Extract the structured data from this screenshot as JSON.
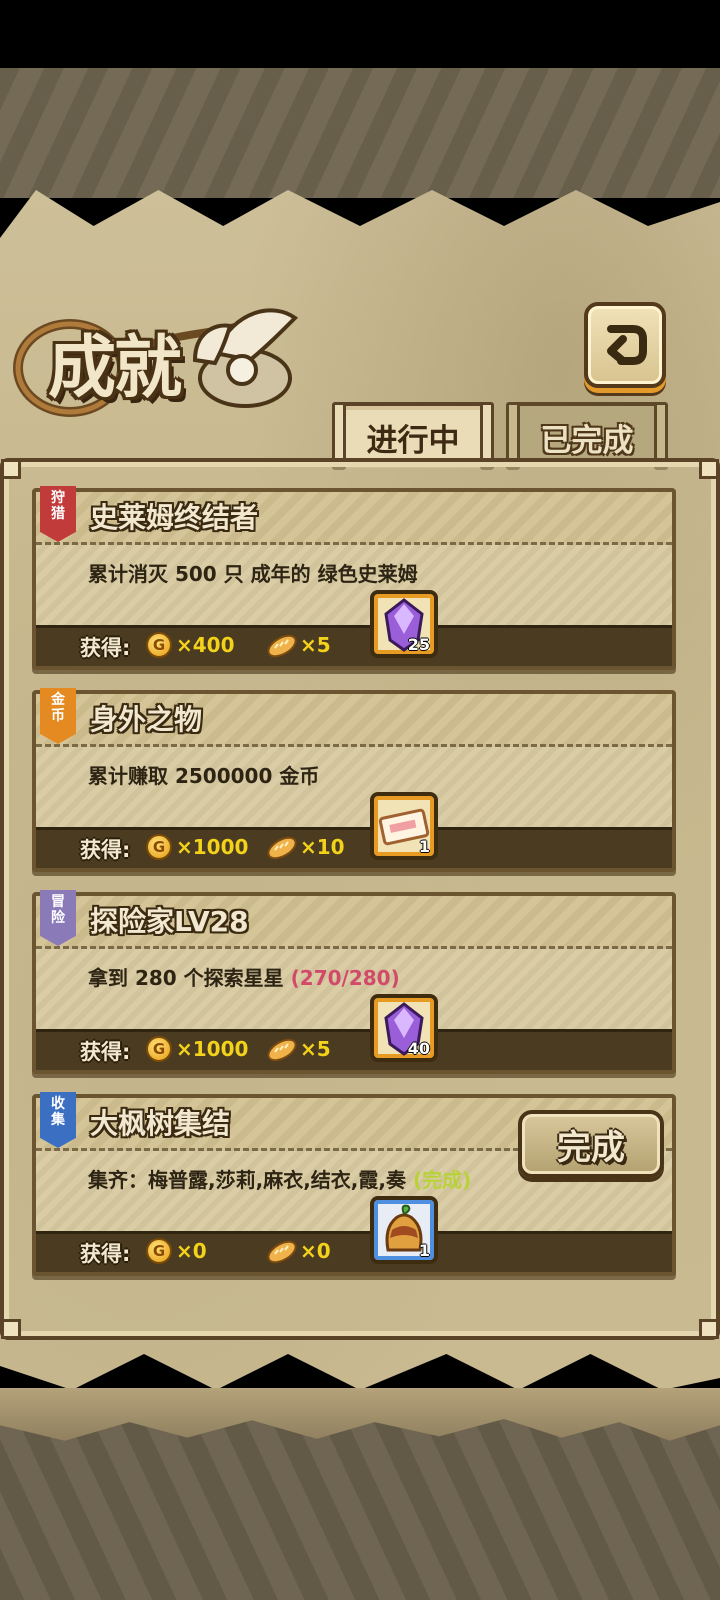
{
  "screen": {
    "title": "成就",
    "back_icon": "return-arrow-icon"
  },
  "tabs": [
    {
      "label": "进行中",
      "active": true
    },
    {
      "label": "已完成",
      "active": false
    }
  ],
  "achievements": [
    {
      "badge": [
        "狩",
        "猎"
      ],
      "badge_color": "#c23b3b",
      "title": "史莱姆终结者",
      "description": "累计消灭 500 只 成年的 绿色史莱姆",
      "progress": "",
      "reward_label": "获得:",
      "gold": "×400",
      "bread": "×5",
      "item_icon": "purple-crystal-icon",
      "item_count": "25"
    },
    {
      "badge": [
        "金",
        "币"
      ],
      "badge_color": "#e58a20",
      "title": "身外之物",
      "description": "累计赚取 2500000 金币",
      "progress": "",
      "reward_label": "获得:",
      "gold": "×1000",
      "bread": "×10",
      "item_icon": "ticket-icon",
      "item_count": "1"
    },
    {
      "badge": [
        "冒",
        "险"
      ],
      "badge_color": "#8a7ab8",
      "title": "探险家LV28",
      "description": "拿到 280 个探索星星",
      "progress": "(270/280)",
      "reward_label": "获得:",
      "gold": "×1000",
      "bread": "×5",
      "item_icon": "purple-crystal-icon",
      "item_count": "40"
    },
    {
      "badge": [
        "收",
        "集"
      ],
      "badge_color": "#3b6fc2",
      "title": "大枫树集结",
      "description": "集齐：梅普露,莎莉,麻衣,结衣,霞,奏",
      "progress": "(完成)",
      "reward_label": "获得:",
      "gold": "×0",
      "bread": "×0",
      "item_icon": "pudding-icon",
      "item_count": "1"
    }
  ],
  "complete_button": "完成",
  "colors": {
    "gold_text": "#f3d21c",
    "progress_text": "#d24a6a",
    "done_text": "#b8d23a"
  }
}
